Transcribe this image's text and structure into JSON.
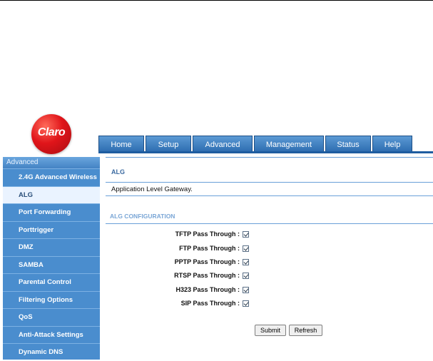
{
  "logo": {
    "text": "Claro"
  },
  "tabs": [
    "Home",
    "Setup",
    "Advanced",
    "Management",
    "Status",
    "Help"
  ],
  "sidebar": {
    "header": "Advanced",
    "items": [
      {
        "label": "2.4G Advanced Wireless",
        "active": false
      },
      {
        "label": "ALG",
        "active": true
      },
      {
        "label": "Port Forwarding",
        "active": false
      },
      {
        "label": "Porttrigger",
        "active": false
      },
      {
        "label": "DMZ",
        "active": false
      },
      {
        "label": "SAMBA",
        "active": false
      },
      {
        "label": "Parental Control",
        "active": false
      },
      {
        "label": "Filtering Options",
        "active": false
      },
      {
        "label": "QoS",
        "active": false
      },
      {
        "label": "Anti-Attack Settings",
        "active": false
      },
      {
        "label": "Dynamic DNS",
        "active": false
      }
    ]
  },
  "main": {
    "title": "ALG",
    "description": "Application Level Gateway.",
    "config_title": "ALG CONFIGURATION",
    "options": [
      {
        "label": "TFTP Pass Through :",
        "checked": true
      },
      {
        "label": "FTP Pass Through :",
        "checked": true
      },
      {
        "label": "PPTP Pass Through :",
        "checked": true
      },
      {
        "label": "RTSP Pass Through :",
        "checked": true
      },
      {
        "label": "H323 Pass Through :",
        "checked": true
      },
      {
        "label": "SIP Pass Through :",
        "checked": true
      }
    ],
    "submit_label": "Submit",
    "refresh_label": "Refresh"
  },
  "colors": {
    "brand_red": "#e0151a",
    "nav_blue": "#2f6eb2",
    "sidebar_blue": "#4a8dce"
  }
}
